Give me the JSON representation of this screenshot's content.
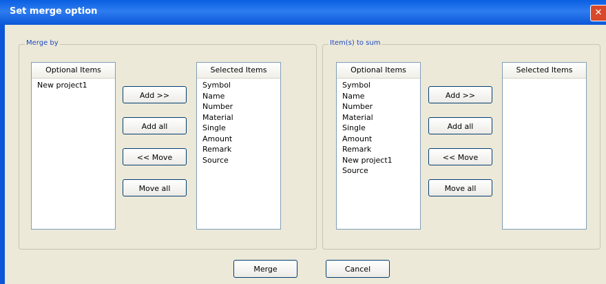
{
  "window": {
    "title": "Set merge option",
    "close_glyph": "✕"
  },
  "merge_by": {
    "label": "Merge by",
    "optional_header": "Optional Items",
    "optional_items": [
      "New project1"
    ],
    "selected_header": "Selected Items",
    "selected_items": [
      "Symbol",
      "Name",
      "Number",
      "Material",
      "Single",
      "Amount",
      "Remark",
      "Source"
    ],
    "buttons": {
      "add": "Add >>",
      "add_all": "Add all",
      "move": "<< Move",
      "move_all": "Move all"
    }
  },
  "items_to_sum": {
    "label": "Item(s) to sum",
    "optional_header": "Optional Items",
    "optional_items": [
      "Symbol",
      "Name",
      "Number",
      "Material",
      "Single",
      "Amount",
      "Remark",
      "New project1",
      "Source"
    ],
    "selected_header": "Selected Items",
    "selected_items": [],
    "buttons": {
      "add": "Add >>",
      "add_all": "Add all",
      "move": "<< Move",
      "move_all": "Move all"
    }
  },
  "footer": {
    "merge": "Merge",
    "cancel": "Cancel"
  }
}
